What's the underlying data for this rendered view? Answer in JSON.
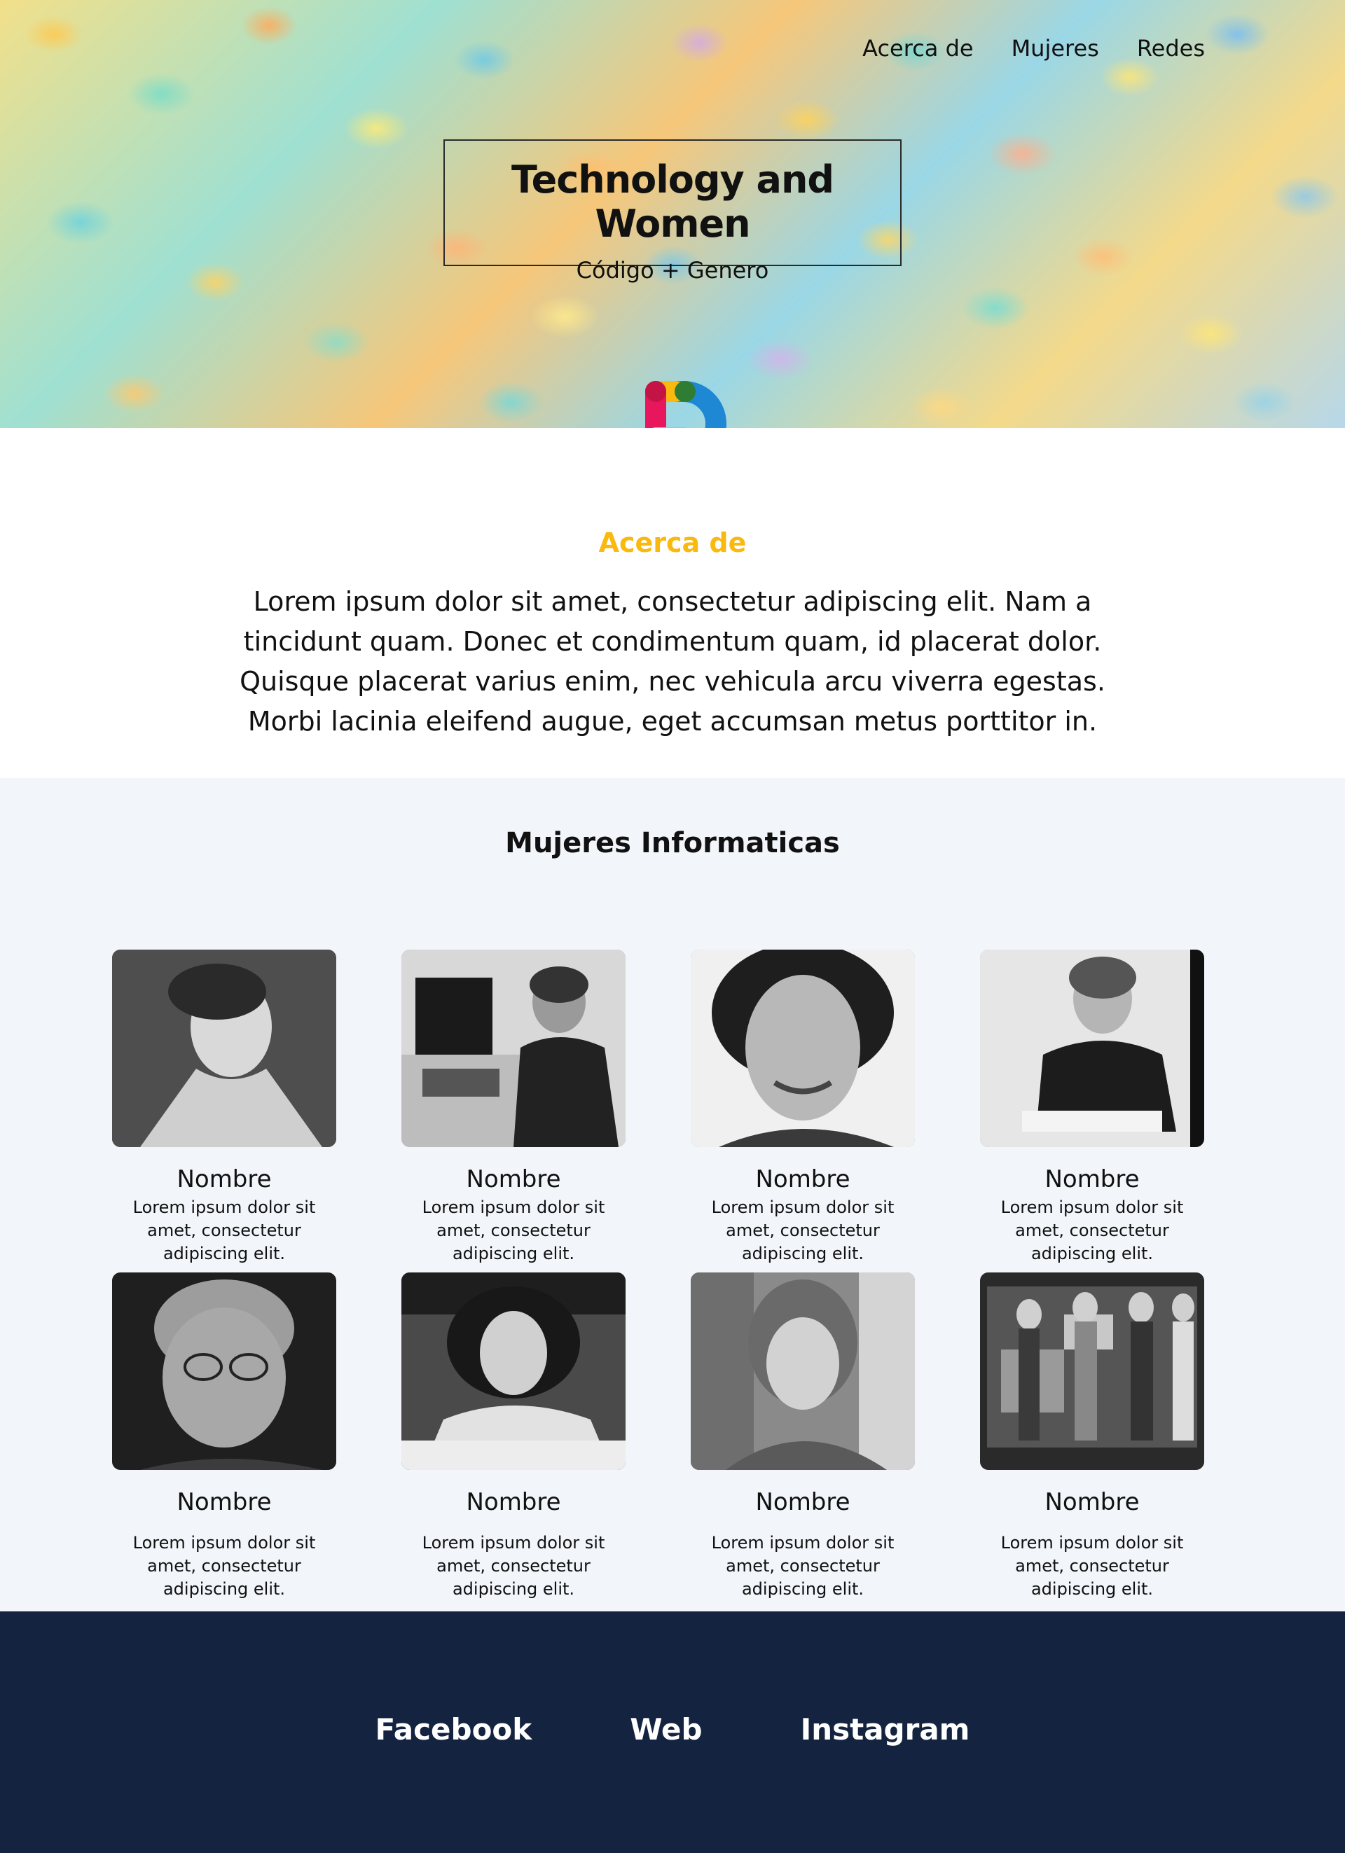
{
  "nav": {
    "items": [
      {
        "label": "Acerca de"
      },
      {
        "label": "Mujeres"
      },
      {
        "label": "Redes"
      }
    ]
  },
  "hero": {
    "title": "Technology and Women",
    "subtitle": "Código + Genero"
  },
  "logo": {
    "icon": "p-logo-icon",
    "colors": [
      "#e8175d",
      "#f9b90f",
      "#1e88d4",
      "#2e8b57"
    ]
  },
  "about": {
    "title": "Acerca de",
    "text": "Lorem ipsum dolor sit amet, consectetur adipiscing elit. Nam a tincidunt quam. Donec et condimentum quam, id placerat dolor. Quisque placerat varius enim, nec vehicula arcu viverra egestas. Morbi lacinia eleifend augue, eget accumsan metus porttitor in."
  },
  "women": {
    "title": "Mujeres Informaticas",
    "cards": [
      {
        "name": "Nombre",
        "description": "Lorem ipsum dolor sit amet, consectetur adipiscing elit."
      },
      {
        "name": "Nombre",
        "description": "Lorem ipsum dolor sit amet, consectetur adipiscing elit."
      },
      {
        "name": "Nombre",
        "description": "Lorem ipsum dolor sit amet, consectetur adipiscing elit."
      },
      {
        "name": "Nombre",
        "description": "Lorem ipsum dolor sit amet, consectetur adipiscing elit."
      },
      {
        "name": "Nombre",
        "description": "Lorem ipsum dolor sit amet, consectetur adipiscing elit."
      },
      {
        "name": "Nombre",
        "description": "Lorem ipsum dolor sit amet, consectetur adipiscing elit."
      },
      {
        "name": "Nombre",
        "description": "Lorem ipsum dolor sit amet, consectetur adipiscing elit."
      },
      {
        "name": "Nombre",
        "description": "Lorem ipsum dolor sit amet, consectetur adipiscing elit."
      }
    ]
  },
  "footer": {
    "links": [
      {
        "label": "Facebook"
      },
      {
        "label": "Web"
      },
      {
        "label": "Instagram"
      }
    ],
    "background": "#142440"
  },
  "colors": {
    "accent": "#f9b90f",
    "section_bg": "#f2f5f9"
  }
}
